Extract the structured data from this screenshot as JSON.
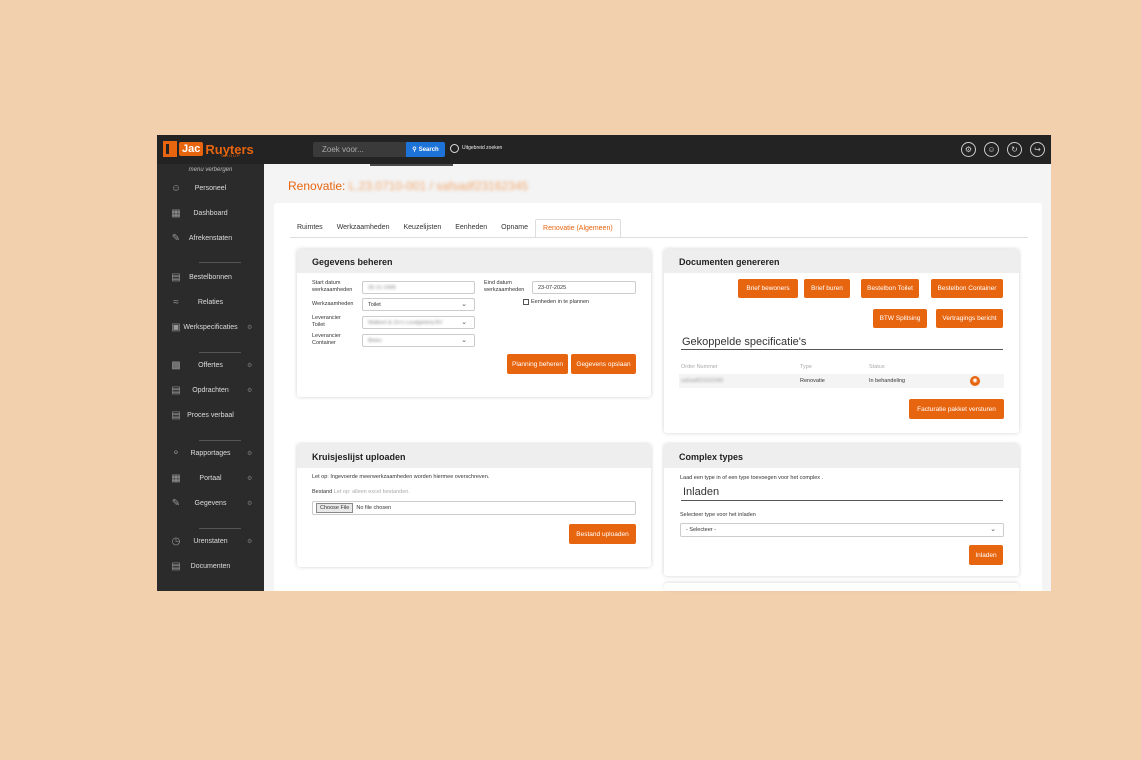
{
  "colors": {
    "accent": "#e8650f",
    "topbar": "#232323",
    "sidebar": "#2b2b2b",
    "search_button": "#1e73d8"
  },
  "logo": {
    "mark_text": "Jac",
    "brand_text": "Ruyters",
    "group_text": "GROUP"
  },
  "header": {
    "search_placeholder": "Zoek voor...",
    "search_button": "Search",
    "advanced_search": "Uitgebreid zoeken",
    "icons": [
      "settings-icon",
      "user-icon",
      "sync-icon",
      "logout-icon"
    ]
  },
  "sidebar": {
    "hide_menu": "menu verbergen",
    "items": [
      {
        "label": "Personeel",
        "icon": "user-icon",
        "gear": false
      },
      {
        "label": "Dashboard",
        "icon": "dashboard-icon",
        "gear": false
      },
      {
        "label": "Afrekenstaten",
        "icon": "edit-icon",
        "gear": false
      },
      {
        "label": "Bestelbonnen",
        "icon": "receipt-icon",
        "gear": false
      },
      {
        "label": "Relaties",
        "icon": "handshake-icon",
        "gear": false
      },
      {
        "label": "Werkspecificaties",
        "icon": "spec-icon",
        "gear": true
      },
      {
        "label": "Offertes",
        "icon": "quote-icon",
        "gear": true
      },
      {
        "label": "Opdrachten",
        "icon": "order-icon",
        "gear": true
      },
      {
        "label": "Proces verbaal",
        "icon": "document-icon",
        "gear": false
      },
      {
        "label": "Rapportages",
        "icon": "report-icon",
        "gear": true
      },
      {
        "label": "Portaal",
        "icon": "portal-icon",
        "gear": true
      },
      {
        "label": "Gegevens",
        "icon": "data-icon",
        "gear": true
      },
      {
        "label": "Urenstaten",
        "icon": "clock-icon",
        "gear": true
      },
      {
        "label": "Documenten",
        "icon": "documents-icon",
        "gear": false
      }
    ]
  },
  "page": {
    "title_prefix": "Renovatie:",
    "title_id": "L.23.0710-001 / safsadf23162345"
  },
  "tabs": [
    "Ruimtes",
    "Werkzaamheden",
    "Keuzelijsten",
    "Eenheden",
    "Opname",
    "Renovatie (Algemeen)"
  ],
  "gegevens": {
    "title": "Gegevens beheren",
    "start_label": "Start datum werkzaamheden",
    "start_value": "30-11-1999",
    "end_label": "Eind datum werkzaamheden",
    "end_value": "23-07-2025",
    "werk_label": "Werkzaamheden",
    "werk_value": "Toilet",
    "plan_label": "Eenheden in te plannen",
    "lev_toilet_label": "Leverancier Toilet",
    "lev_toilet_value": "Walbert & Zn's Loodgieterij BV",
    "lev_container_label": "Leverancier Container",
    "lev_container_value": "Bleko",
    "planning_button": "Planning beheren",
    "save_button": "Gegevens opslaan"
  },
  "documenten": {
    "title": "Documenten genereren",
    "buttons": [
      "Brief bewoners",
      "Brief buren",
      "Bestelbon Toilet",
      "Bestelbon Container",
      "BTW Splitsing",
      "Vertragings bericht"
    ],
    "spec_title": "Gekoppelde specificatie's",
    "columns": [
      "Order Nummer",
      "Type",
      "Status"
    ],
    "rows": [
      {
        "order": "safsadf23162345",
        "type": "Renovatie",
        "status": "In behandeling"
      }
    ],
    "invoice_button": "Facturatie pakket versturen"
  },
  "kruisjeslijst": {
    "title": "Kruisjeslijst uploaden",
    "warning": "Let op: Ingevoerde meerwerkzaamheden worden hiermee overschreven.",
    "file_label": "Bestand",
    "file_hint": "Let op: alleen excel bestanden.",
    "choose_button": "Choose File",
    "no_file": "No file chosen",
    "upload_button": "Bestand uploaden"
  },
  "complex": {
    "title": "Complex types",
    "intro": "Laad een type in of een type toevoegen voor het complex .",
    "load_heading": "Inladen",
    "select_label": "Selecteer type voor het inladen",
    "select_value": "- Selecteer -",
    "load_button": "Inladen"
  }
}
